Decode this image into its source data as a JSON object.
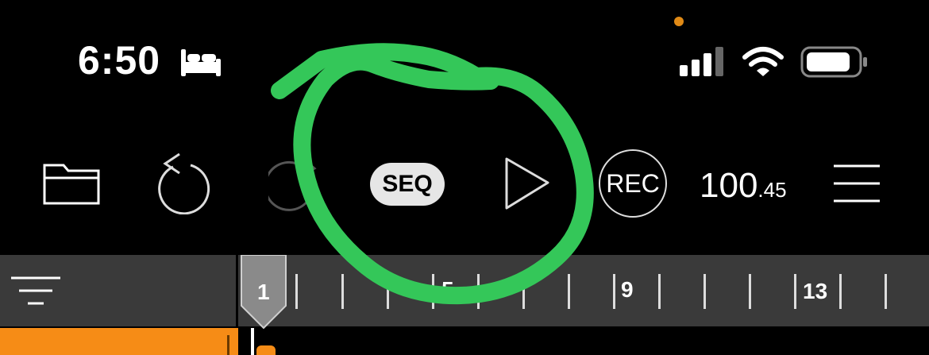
{
  "status_bar": {
    "time": "6:50",
    "sleep_icon": "bed-icon",
    "signal_icon": "cellular-signal-icon",
    "wifi_icon": "wifi-icon",
    "battery_icon": "battery-icon",
    "indicator_color": "#e08a16"
  },
  "toolbar": {
    "folder_icon": "folder-icon",
    "undo_icon": "undo-icon",
    "redo_icon": "redo-icon",
    "seq_label": "SEQ",
    "play_icon": "play-icon",
    "rec_label": "REC",
    "tempo_main": "100",
    "tempo_fraction": ".45",
    "menu_icon": "hamburger-menu-icon"
  },
  "ruler": {
    "filter_icon": "filter-icon",
    "bar_labels": [
      "1",
      "5",
      "9",
      "13"
    ],
    "playhead_label": "1"
  },
  "annotation": {
    "color": "#34c759"
  },
  "colors": {
    "track_accent": "#f68c16",
    "ruler_bg": "#3a3a3a"
  }
}
